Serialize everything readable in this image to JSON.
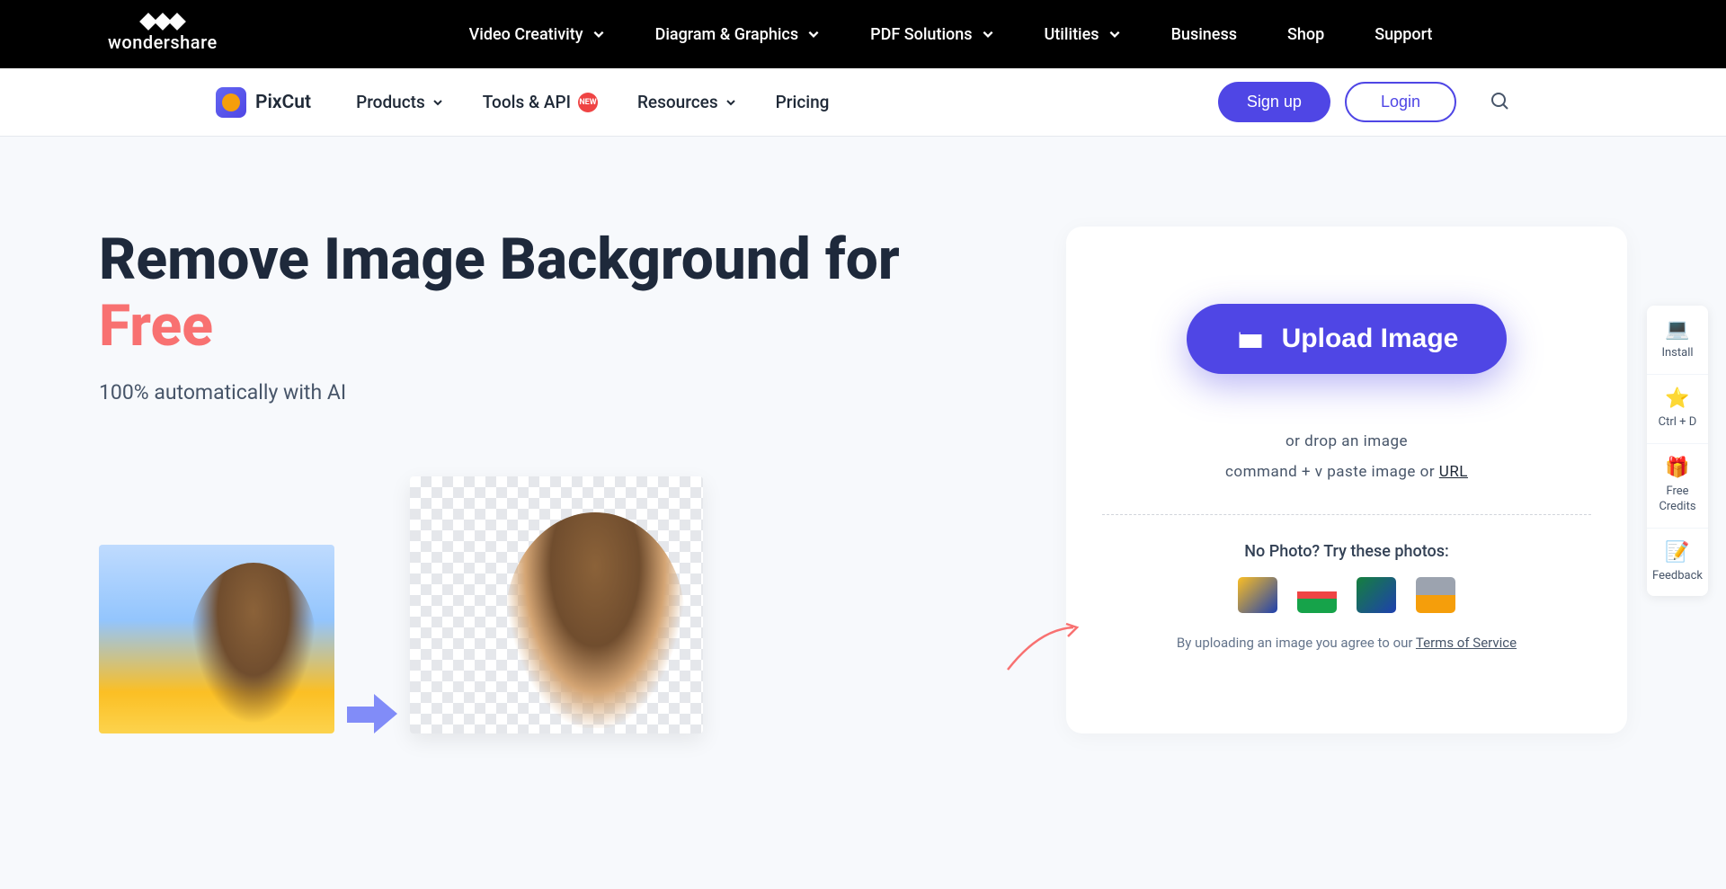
{
  "brand": "wondershare",
  "topNav": [
    {
      "label": "Video Creativity",
      "hasDropdown": true
    },
    {
      "label": "Diagram & Graphics",
      "hasDropdown": true
    },
    {
      "label": "PDF Solutions",
      "hasDropdown": true
    },
    {
      "label": "Utilities",
      "hasDropdown": true
    },
    {
      "label": "Business",
      "hasDropdown": false
    },
    {
      "label": "Shop",
      "hasDropdown": false
    },
    {
      "label": "Support",
      "hasDropdown": false
    }
  ],
  "product": {
    "name": "PixCut"
  },
  "subNav": [
    {
      "label": "Products",
      "hasDropdown": true,
      "badge": null
    },
    {
      "label": "Tools & API",
      "hasDropdown": false,
      "badge": "NEW"
    },
    {
      "label": "Resources",
      "hasDropdown": true,
      "badge": null
    },
    {
      "label": "Pricing",
      "hasDropdown": false,
      "badge": null
    }
  ],
  "auth": {
    "signup": "Sign up",
    "login": "Login"
  },
  "hero": {
    "titlePre": "Remove Image Background for ",
    "titleAccent": "Free",
    "subtitle": "100% automatically with AI"
  },
  "upload": {
    "button": "Upload Image",
    "hint1": "or drop an image",
    "hint2pre": "command + v paste image or ",
    "hint2link": "URL",
    "tryText": "No Photo? Try these photos:",
    "tosPre": "By uploading an image you agree to our ",
    "tosLink": "Terms of Service"
  },
  "sidebar": [
    {
      "label": "Install",
      "icon": "💻"
    },
    {
      "label": "Ctrl + D",
      "icon": "⭐"
    },
    {
      "label": "Free Credits",
      "icon": "🎁"
    },
    {
      "label": "Feedback",
      "icon": "📝"
    }
  ]
}
